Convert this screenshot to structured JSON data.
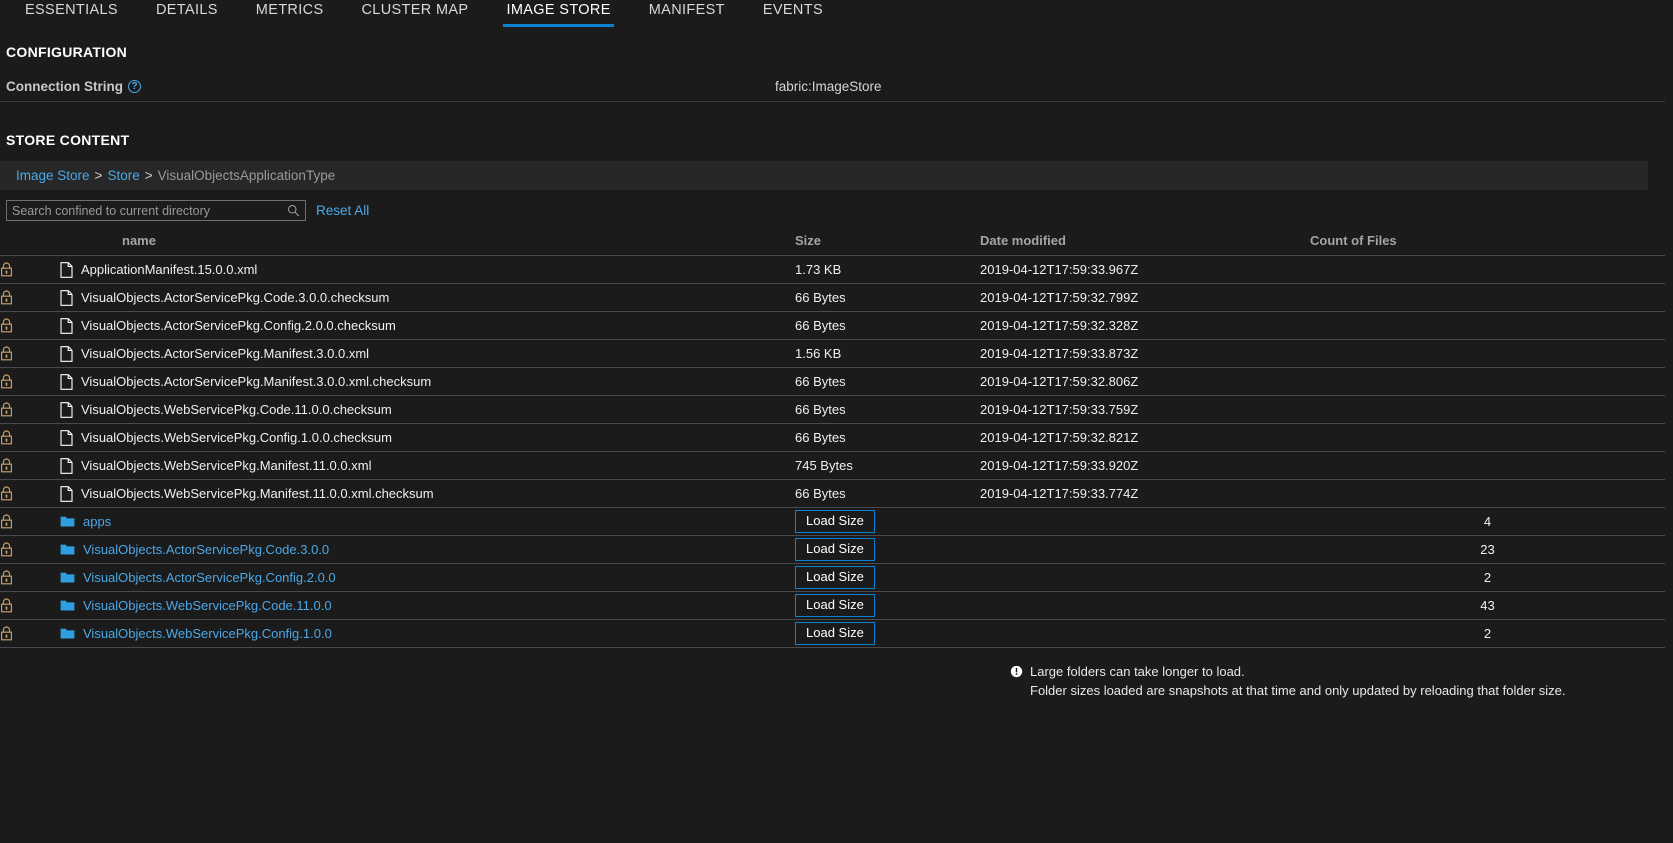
{
  "tabs": [
    {
      "label": "ESSENTIALS",
      "active": false
    },
    {
      "label": "DETAILS",
      "active": false
    },
    {
      "label": "METRICS",
      "active": false
    },
    {
      "label": "CLUSTER MAP",
      "active": false
    },
    {
      "label": "IMAGE STORE",
      "active": true
    },
    {
      "label": "MANIFEST",
      "active": false
    },
    {
      "label": "EVENTS",
      "active": false
    }
  ],
  "configuration": {
    "title": "CONFIGURATION",
    "connection_string_label": "Connection String",
    "help_icon": "question-mark-icon",
    "connection_string_value": "fabric:ImageStore"
  },
  "store_content": {
    "title": "STORE CONTENT",
    "breadcrumb": {
      "items": [
        {
          "label": "Image Store",
          "link": true
        },
        {
          "label": "Store",
          "link": true
        },
        {
          "label": "VisualObjectsApplicationType",
          "link": false
        }
      ],
      "separator": ">"
    },
    "search": {
      "placeholder": "Search confined to current directory",
      "value": "",
      "icon": "search-icon"
    },
    "reset_all_label": "Reset All",
    "columns": {
      "lock": "",
      "name": "name",
      "size": "Size",
      "date_modified": "Date modified",
      "count_of_files": "Count of Files"
    },
    "load_size_label": "Load Size",
    "rows": [
      {
        "type": "file",
        "icon": "file-icon",
        "lock": "lock-icon",
        "name": "ApplicationManifest.15.0.0.xml",
        "size": "1.73 KB",
        "date": "2019-04-12T17:59:33.967Z",
        "count": ""
      },
      {
        "type": "file",
        "icon": "file-icon",
        "lock": "lock-icon",
        "name": "VisualObjects.ActorServicePkg.Code.3.0.0.checksum",
        "size": "66 Bytes",
        "date": "2019-04-12T17:59:32.799Z",
        "count": ""
      },
      {
        "type": "file",
        "icon": "file-icon",
        "lock": "lock-icon",
        "name": "VisualObjects.ActorServicePkg.Config.2.0.0.checksum",
        "size": "66 Bytes",
        "date": "2019-04-12T17:59:32.328Z",
        "count": ""
      },
      {
        "type": "file",
        "icon": "file-icon",
        "lock": "lock-icon",
        "name": "VisualObjects.ActorServicePkg.Manifest.3.0.0.xml",
        "size": "1.56 KB",
        "date": "2019-04-12T17:59:33.873Z",
        "count": ""
      },
      {
        "type": "file",
        "icon": "file-icon",
        "lock": "lock-icon",
        "name": "VisualObjects.ActorServicePkg.Manifest.3.0.0.xml.checksum",
        "size": "66 Bytes",
        "date": "2019-04-12T17:59:32.806Z",
        "count": ""
      },
      {
        "type": "file",
        "icon": "file-icon",
        "lock": "lock-icon",
        "name": "VisualObjects.WebServicePkg.Code.11.0.0.checksum",
        "size": "66 Bytes",
        "date": "2019-04-12T17:59:33.759Z",
        "count": ""
      },
      {
        "type": "file",
        "icon": "file-icon",
        "lock": "lock-icon",
        "name": "VisualObjects.WebServicePkg.Config.1.0.0.checksum",
        "size": "66 Bytes",
        "date": "2019-04-12T17:59:32.821Z",
        "count": ""
      },
      {
        "type": "file",
        "icon": "file-icon",
        "lock": "lock-icon",
        "name": "VisualObjects.WebServicePkg.Manifest.11.0.0.xml",
        "size": "745 Bytes",
        "date": "2019-04-12T17:59:33.920Z",
        "count": ""
      },
      {
        "type": "file",
        "icon": "file-icon",
        "lock": "lock-icon",
        "name": "VisualObjects.WebServicePkg.Manifest.11.0.0.xml.checksum",
        "size": "66 Bytes",
        "date": "2019-04-12T17:59:33.774Z",
        "count": ""
      },
      {
        "type": "folder",
        "icon": "folder-icon",
        "lock": "lock-icon",
        "name": "apps",
        "size": "",
        "date": "",
        "count": "4"
      },
      {
        "type": "folder",
        "icon": "folder-icon",
        "lock": "lock-icon",
        "name": "VisualObjects.ActorServicePkg.Code.3.0.0",
        "size": "",
        "date": "",
        "count": "23"
      },
      {
        "type": "folder",
        "icon": "folder-icon",
        "lock": "lock-icon",
        "name": "VisualObjects.ActorServicePkg.Config.2.0.0",
        "size": "",
        "date": "",
        "count": "2"
      },
      {
        "type": "folder",
        "icon": "folder-icon",
        "lock": "lock-icon",
        "name": "VisualObjects.WebServicePkg.Code.11.0.0",
        "size": "",
        "date": "",
        "count": "43"
      },
      {
        "type": "folder",
        "icon": "folder-icon",
        "lock": "lock-icon",
        "name": "VisualObjects.WebServicePkg.Config.1.0.0",
        "size": "",
        "date": "",
        "count": "2"
      }
    ],
    "note": {
      "icon": "alert-circle-icon",
      "line1": "Large folders can take longer to load.",
      "line2": "Folder sizes loaded are snapshots at that time and only updated by reloading that folder size."
    }
  },
  "colors": {
    "accent": "#0c82d4",
    "link": "#4aa8e8",
    "background": "#1b1b1b",
    "breadcrumb_bg": "#272727",
    "border": "#4a4a4a"
  }
}
